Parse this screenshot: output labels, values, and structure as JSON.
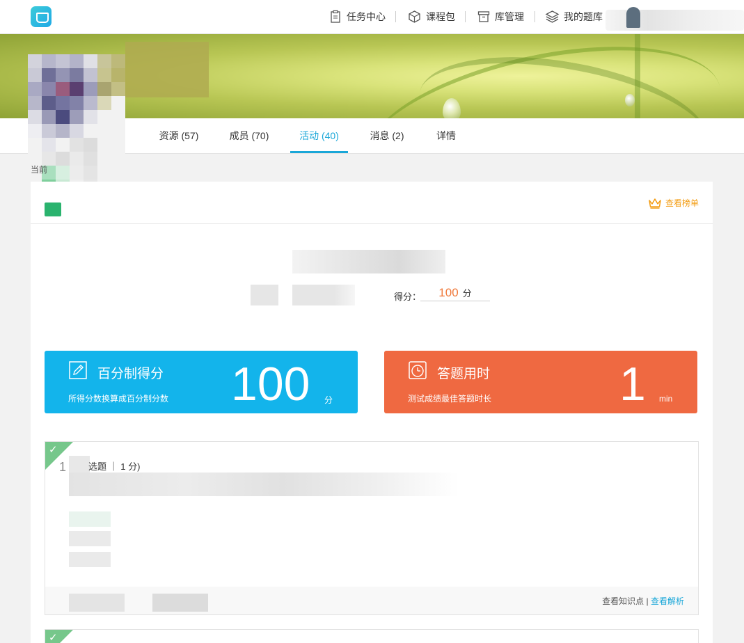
{
  "topnav": {
    "items": [
      {
        "label": "任务中心",
        "icon": "clipboard-icon"
      },
      {
        "label": "课程包",
        "icon": "package-icon"
      },
      {
        "label": "库管理",
        "icon": "archive-icon"
      },
      {
        "label": "我的题库",
        "icon": "layers-icon"
      }
    ]
  },
  "tabs": [
    {
      "label": "资源 (57)"
    },
    {
      "label": "成员 (70)"
    },
    {
      "label": "活动 (40)",
      "active": true
    },
    {
      "label": "消息 (2)"
    },
    {
      "label": "详情"
    }
  ],
  "breadcrumb": {
    "prefix": "当前"
  },
  "panel": {
    "rank_link": "查看榜单",
    "score_label": "得分：",
    "score_value": "100",
    "score_unit": "分"
  },
  "stats": {
    "percent": {
      "title": "百分制得分",
      "desc": "所得分数换算成百分制分数",
      "value": "100",
      "unit": "分",
      "color": "#13b4eb"
    },
    "time": {
      "title": "答题用时",
      "desc": "测试成绩最佳答题时长",
      "value": "1",
      "unit": "min",
      "color": "#ef6941"
    }
  },
  "question": {
    "number": "1",
    "type_suffix": "选题 ｜ 1 分)",
    "check": "✓",
    "link_knowledge": "查看知识点",
    "link_sep": "|",
    "link_analysis": "查看解析"
  },
  "question2": {
    "check": "✓"
  }
}
